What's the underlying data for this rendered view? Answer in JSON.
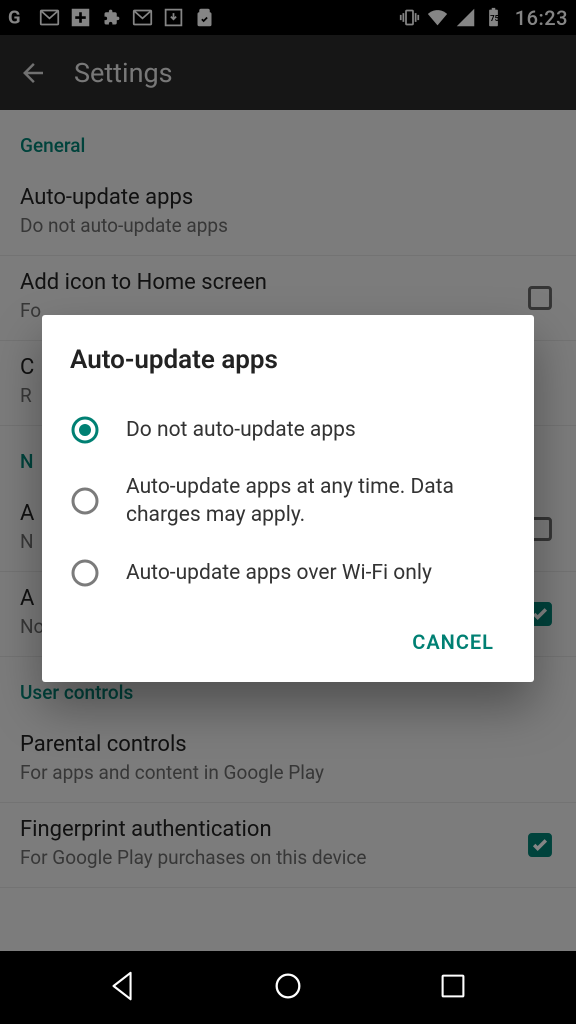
{
  "status": {
    "time": "16:23",
    "battery": "75"
  },
  "actionBar": {
    "title": "Settings"
  },
  "sections": {
    "general": {
      "header": "General",
      "autoUpdate": {
        "title": "Auto-update apps",
        "sub": "Do not auto-update apps"
      },
      "addIcon": {
        "title": "Add icon to Home screen",
        "sub": "Fo"
      },
      "c": {
        "title": "C",
        "sub": "R"
      }
    },
    "n": {
      "header": "N",
      "a": {
        "title": "A",
        "sub": "N"
      },
      "a2": {
        "title": "A",
        "sub": "Notify when apps are automatically updated"
      }
    },
    "user": {
      "header": "User controls",
      "parental": {
        "title": "Parental controls",
        "sub": "For apps and content in Google Play"
      },
      "fingerprint": {
        "title": "Fingerprint authentication",
        "sub": "For Google Play purchases on this device"
      }
    }
  },
  "dialog": {
    "title": "Auto-update apps",
    "options": [
      {
        "label": "Do not auto-update apps",
        "selected": true
      },
      {
        "label": "Auto-update apps at any time. Data charges may apply.",
        "selected": false
      },
      {
        "label": "Auto-update apps over Wi-Fi only",
        "selected": false
      }
    ],
    "cancel": "CANCEL"
  }
}
